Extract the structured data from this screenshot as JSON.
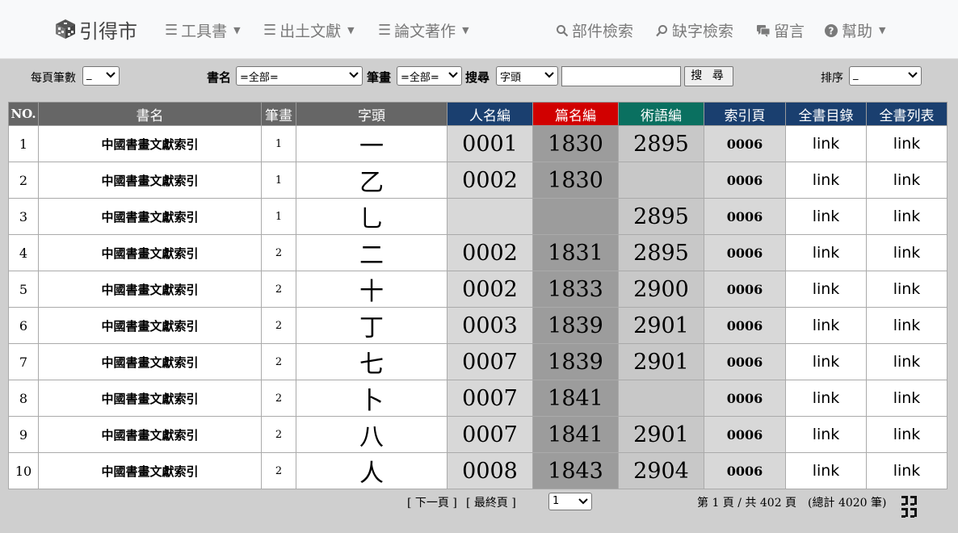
{
  "nav": {
    "brand": "引得市",
    "items": [
      {
        "label": "工具書",
        "icon": "menu-icon",
        "dropdown": true
      },
      {
        "label": "出土文獻",
        "icon": "menu-icon",
        "dropdown": true
      },
      {
        "label": "論文著作",
        "icon": "menu-icon",
        "dropdown": true
      },
      {
        "label": "部件檢索",
        "icon": "search-icon"
      },
      {
        "label": "缺字檢索",
        "icon": "search-icon"
      },
      {
        "label": "留言",
        "icon": "comment-icon"
      },
      {
        "label": "幫助",
        "icon": "help-icon",
        "dropdown": true
      }
    ]
  },
  "filters": {
    "per_page_label": "每頁筆數",
    "per_page_value": "_",
    "book_label": "書名",
    "book_value": "=全部=",
    "stroke_label": "筆畫",
    "stroke_value": "=全部=",
    "search_label": "搜尋",
    "search_field_value": "字頭",
    "search_text": "",
    "search_button": "搜 尋",
    "sort_label": "排序",
    "sort_value": "_"
  },
  "table": {
    "headers": [
      "NO.",
      "書名",
      "筆畫",
      "字頭",
      "人名編",
      "篇名編",
      "術語編",
      "索引頁",
      "全書目錄",
      "全書列表"
    ],
    "rows": [
      {
        "no": "1",
        "book": "中國書畫文獻索引",
        "strokes": "1",
        "char": "一",
        "a": "0001",
        "b": "1830",
        "c": "2895",
        "idx": "0006",
        "toc": "link",
        "list": "link"
      },
      {
        "no": "2",
        "book": "中國書畫文獻索引",
        "strokes": "1",
        "char": "乙",
        "a": "0002",
        "b": "1830",
        "c": "",
        "idx": "0006",
        "toc": "link",
        "list": "link"
      },
      {
        "no": "3",
        "book": "中國書畫文獻索引",
        "strokes": "1",
        "char": "乚",
        "a": "",
        "b": "",
        "c": "2895",
        "idx": "0006",
        "toc": "link",
        "list": "link"
      },
      {
        "no": "4",
        "book": "中國書畫文獻索引",
        "strokes": "2",
        "char": "二",
        "a": "0002",
        "b": "1831",
        "c": "2895",
        "idx": "0006",
        "toc": "link",
        "list": "link"
      },
      {
        "no": "5",
        "book": "中國書畫文獻索引",
        "strokes": "2",
        "char": "十",
        "a": "0002",
        "b": "1833",
        "c": "2900",
        "idx": "0006",
        "toc": "link",
        "list": "link"
      },
      {
        "no": "6",
        "book": "中國書畫文獻索引",
        "strokes": "2",
        "char": "丁",
        "a": "0003",
        "b": "1839",
        "c": "2901",
        "idx": "0006",
        "toc": "link",
        "list": "link"
      },
      {
        "no": "7",
        "book": "中國書畫文獻索引",
        "strokes": "2",
        "char": "七",
        "a": "0007",
        "b": "1839",
        "c": "2901",
        "idx": "0006",
        "toc": "link",
        "list": "link"
      },
      {
        "no": "8",
        "book": "中國書畫文獻索引",
        "strokes": "2",
        "char": "卜",
        "a": "0007",
        "b": "1841",
        "c": "",
        "idx": "0006",
        "toc": "link",
        "list": "link"
      },
      {
        "no": "9",
        "book": "中國書畫文獻索引",
        "strokes": "2",
        "char": "八",
        "a": "0007",
        "b": "1841",
        "c": "2901",
        "idx": "0006",
        "toc": "link",
        "list": "link"
      },
      {
        "no": "10",
        "book": "中國書畫文獻索引",
        "strokes": "2",
        "char": "人",
        "a": "0008",
        "b": "1843",
        "c": "2904",
        "idx": "0006",
        "toc": "link",
        "list": "link"
      }
    ]
  },
  "pager": {
    "next": "[ 下一頁 ]",
    "last": "[ 最終頁 ]",
    "page_select": "1",
    "summary": "第 1 頁 / 共 402 頁　(總計 4020 筆)"
  },
  "colors": {
    "header_gray": "#666666",
    "header_blue": "#1a3f6f",
    "header_red": "#d10000",
    "header_teal": "#0a7060"
  }
}
